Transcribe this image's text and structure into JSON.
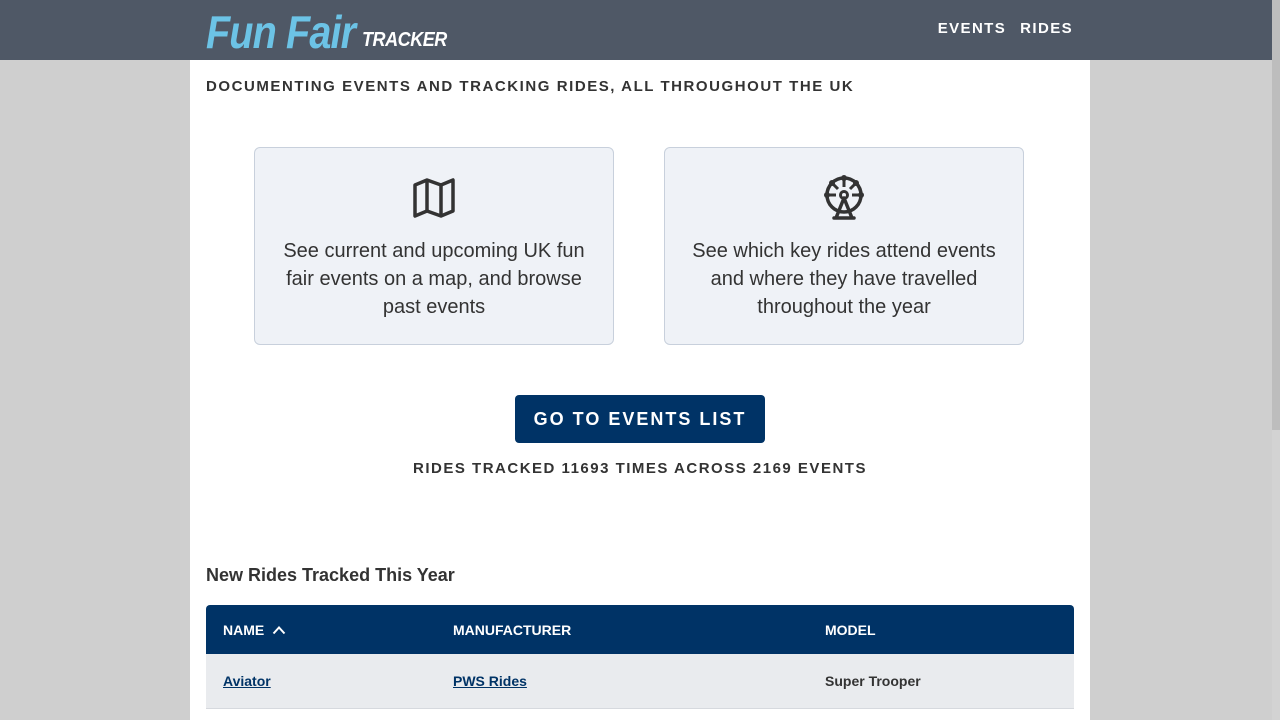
{
  "header": {
    "logo_main": "Fun Fair",
    "logo_sub": "TRACKER",
    "nav": [
      {
        "label": "EVENTS"
      },
      {
        "label": "RIDES"
      }
    ]
  },
  "tagline": "DOCUMENTING EVENTS AND TRACKING RIDES, ALL THROUGHOUT THE UK",
  "cards": [
    {
      "icon": "map-icon",
      "text": "See current and upcoming UK fun fair events on a map, and browse past events"
    },
    {
      "icon": "ferris-wheel-icon",
      "text": "See which key rides attend events and where they have travelled throughout the year"
    }
  ],
  "cta_label": "GO TO EVENTS LIST",
  "stats_text": "RIDES TRACKED 11693 TIMES ACROSS 2169 EVENTS",
  "new_rides": {
    "title": "New Rides Tracked This Year",
    "columns": [
      "NAME",
      "MANUFACTURER",
      "MODEL"
    ],
    "sort_icon": "chevron-up-icon",
    "rows": [
      {
        "name": "Aviator",
        "manufacturer": "PWS Rides",
        "model": "Super Trooper"
      }
    ]
  },
  "colors": {
    "header_bg": "#4f5866",
    "logo_accent": "#6cc3e6",
    "primary": "#003366",
    "card_bg": "#eff2f7"
  }
}
